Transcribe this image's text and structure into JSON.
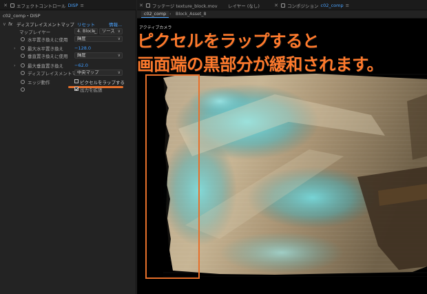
{
  "left_panel": {
    "tab1_label": "エフェクトコントロール",
    "tab1_comp": "DISP",
    "comp_path": "c02_comp・DISP",
    "effect": {
      "fx_label": "fx",
      "name": "ディスプレイスメントマップ",
      "reset": "リセット",
      "about": "情報..."
    },
    "rows": {
      "map_layer": {
        "label": "マップレイヤー",
        "value": "4. Block_",
        "source": "ソース"
      },
      "h_use": {
        "label": "水平置き換えに使用",
        "value": "輝度"
      },
      "h_max": {
        "label": "最大水平置き換え",
        "value": "−128.0"
      },
      "v_use": {
        "label": "垂直置き換えに使用",
        "value": "輝度"
      },
      "v_max": {
        "label": "最大垂直置き換え",
        "value": "−62.0"
      },
      "dmap_behavior": {
        "label": "ディスプレイスメントマッ",
        "value": "中央マップ"
      },
      "edge": {
        "label": "エッジ動作",
        "wrap": "ピクセルをラップする",
        "expand": "出力を拡張"
      }
    }
  },
  "right_panel": {
    "footage_tab": "フッテージ texture_block.mov",
    "layer_tab": "レイヤー (なし)",
    "comp_tab_prefix": "コンポジション",
    "comp_tab_name": "c02_comp",
    "subtabs": [
      "c02_comp",
      "Block_Asset_8"
    ],
    "active_camera": "アクティブカメラ"
  },
  "annotation": {
    "line1": "ピクセルをラップすると",
    "line2": "画面端の黒部分が緩和されます。",
    "color": "#e8702a"
  },
  "colors": {
    "accent_blue": "#3d9bff",
    "panel_bg": "#232323",
    "viewer_bg": "#000000",
    "texture_light": "#c9b79a",
    "texture_cyan": "#4fd3df"
  }
}
